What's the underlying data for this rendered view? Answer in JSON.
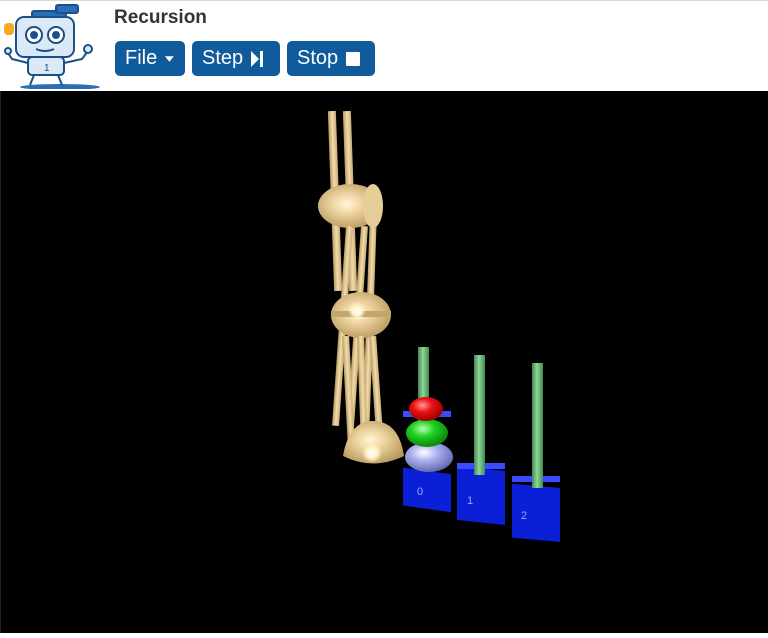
{
  "app": {
    "title": "Recursion"
  },
  "toolbar": {
    "file_label": "File",
    "step_label": "Step",
    "stop_label": "Stop"
  },
  "icons": {
    "file": "caret-down-icon",
    "step": "step-forward-icon",
    "stop": "stop-square-icon"
  },
  "colors": {
    "button_bg": "#0f5b9c",
    "scene_bg": "#000000",
    "arm": "#e8cf9a",
    "peg": "#5fb56f",
    "base": "#0a1fd6"
  },
  "pegs": [
    {
      "label": "0"
    },
    {
      "label": "1"
    },
    {
      "label": "2"
    }
  ],
  "discs": [
    "red",
    "green",
    "lavender"
  ]
}
